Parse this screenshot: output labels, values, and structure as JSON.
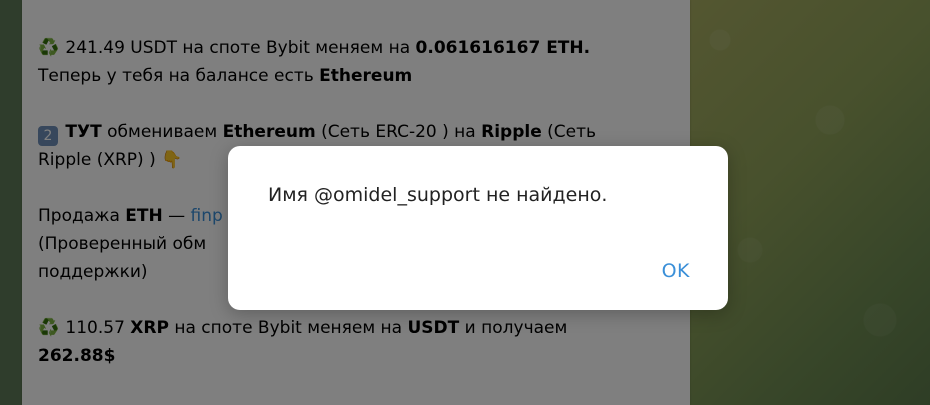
{
  "message": {
    "top_fragment": "…",
    "block1": {
      "emoji": "♻️",
      "amount": "241.49 USDT на споте Bybit меняем на ",
      "eth_amount": "0.061616167 ETH.",
      "line2_prefix": "Теперь у тебя на балансе есть ",
      "line2_bold": "Ethereum"
    },
    "block2": {
      "num_emoji": "2",
      "bold1": "ТУТ",
      "text1": " обмениваем ",
      "bold2": "Ethereum",
      "text2": " (Сеть ERC-20 ) на ",
      "bold3": "Ripple",
      "text3": " (Сеть",
      "line2": "Ripple (XRP) ) ",
      "hand_emoji": "👇"
    },
    "block3": {
      "prefix": "Продажа ",
      "bold": "ETH",
      "dash": " — ",
      "link_text": "finp",
      "line2": "(Проверенный обм",
      "line3": "поддержки)"
    },
    "block4": {
      "emoji": "♻️",
      "amount": "110.57 ",
      "bold1": "XRP",
      "text1": " на споте Bybit меняем на ",
      "bold2": "USDT",
      "text2": " и получаем",
      "line2_bold": "262.88$"
    }
  },
  "dialog": {
    "text": "Имя @omidel_support не найдено.",
    "ok_label": "OK"
  },
  "colors": {
    "link": "#3a8fd8",
    "overlay": "rgba(0,0,0,0.5)"
  }
}
